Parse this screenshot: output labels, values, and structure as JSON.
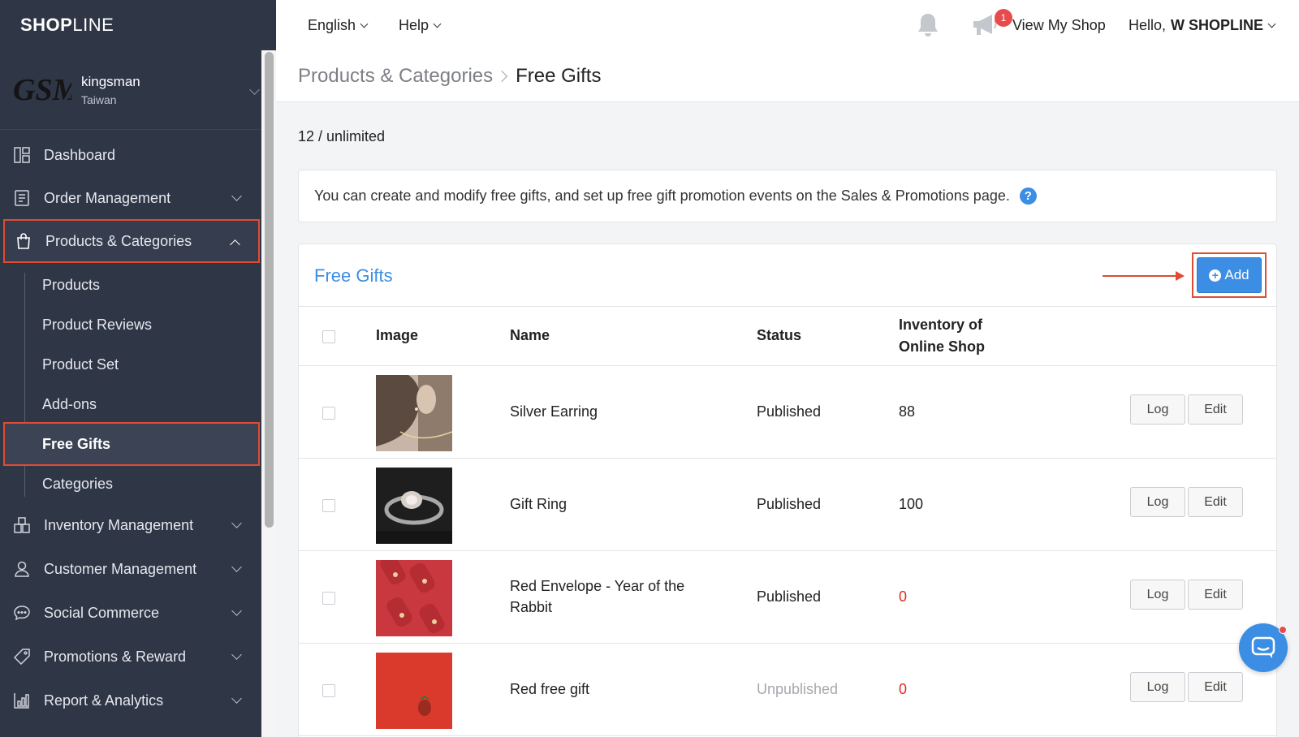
{
  "brand": {
    "name_bold": "SHOP",
    "name_thin": "LINE"
  },
  "shop": {
    "logo_text": "GSM",
    "name": "kingsman",
    "region": "Taiwan"
  },
  "sidebar": {
    "items": [
      {
        "label": "Dashboard"
      },
      {
        "label": "Order Management"
      },
      {
        "label": "Products & Categories"
      },
      {
        "label": "Inventory Management"
      },
      {
        "label": "Customer Management"
      },
      {
        "label": "Social Commerce"
      },
      {
        "label": "Promotions & Reward"
      },
      {
        "label": "Report & Analytics"
      }
    ],
    "subitems": [
      {
        "label": "Products"
      },
      {
        "label": "Product Reviews"
      },
      {
        "label": "Product Set"
      },
      {
        "label": "Add-ons"
      },
      {
        "label": "Free Gifts"
      },
      {
        "label": "Categories"
      }
    ]
  },
  "topbar": {
    "language": "English",
    "help": "Help",
    "notification_count": "1",
    "view_shop": "View My Shop",
    "greeting": "Hello,",
    "user": "W SHOPLINE"
  },
  "breadcrumb": {
    "parent": "Products & Categories",
    "current": "Free Gifts"
  },
  "quota": "12 / unlimited",
  "info_text": "You can create and modify free gifts, and set up free gift promotion events on the Sales & Promotions page.",
  "help_icon": "?",
  "panel": {
    "title": "Free Gifts",
    "add_label": "Add",
    "add_icon": "+",
    "columns": {
      "image": "Image",
      "name": "Name",
      "status": "Status",
      "inventory_line1": "Inventory of",
      "inventory_line2": "Online Shop"
    },
    "log_label": "Log",
    "edit_label": "Edit",
    "rows": [
      {
        "name": "Silver Earring",
        "name_line2": "",
        "status": "Published",
        "inventory": "88"
      },
      {
        "name": "Gift Ring",
        "name_line2": "",
        "status": "Published",
        "inventory": "100"
      },
      {
        "name": "Red Envelope - Year of the",
        "name_line2": "Rabbit",
        "status": "Published",
        "inventory": "0"
      },
      {
        "name": "Red free gift",
        "name_line2": "",
        "status": "Unpublished",
        "inventory": "0"
      }
    ]
  },
  "colors": {
    "accent": "#3b8ee3",
    "highlight": "#e04b34",
    "sidebar_bg": "#2f3646",
    "alert": "#e02b20"
  }
}
